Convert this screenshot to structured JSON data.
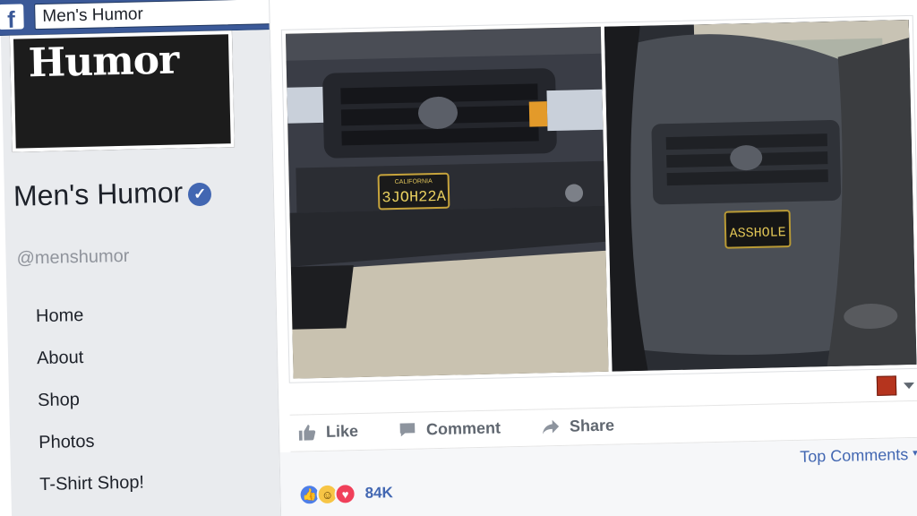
{
  "header": {
    "logo": "f",
    "search_value": "Men's Humor"
  },
  "sidebar": {
    "cover_text": "Humor",
    "page_name": "Men's Humor",
    "handle": "@menshumor",
    "items": [
      {
        "label": "Home"
      },
      {
        "label": "About"
      },
      {
        "label": "Shop"
      },
      {
        "label": "Photos"
      },
      {
        "label": "T-Shirt Shop!"
      }
    ]
  },
  "post": {
    "plate_left_state": "CALIFORNIA",
    "plate_left_text": "3JOH22A",
    "plate_right_text": "ASSHOLE",
    "actions": {
      "like": "Like",
      "comment": "Comment",
      "share": "Share"
    },
    "top_comments": "Top Comments",
    "reaction_count": "84K"
  },
  "colors": {
    "brand": "#3b5998",
    "link": "#4267b2"
  }
}
